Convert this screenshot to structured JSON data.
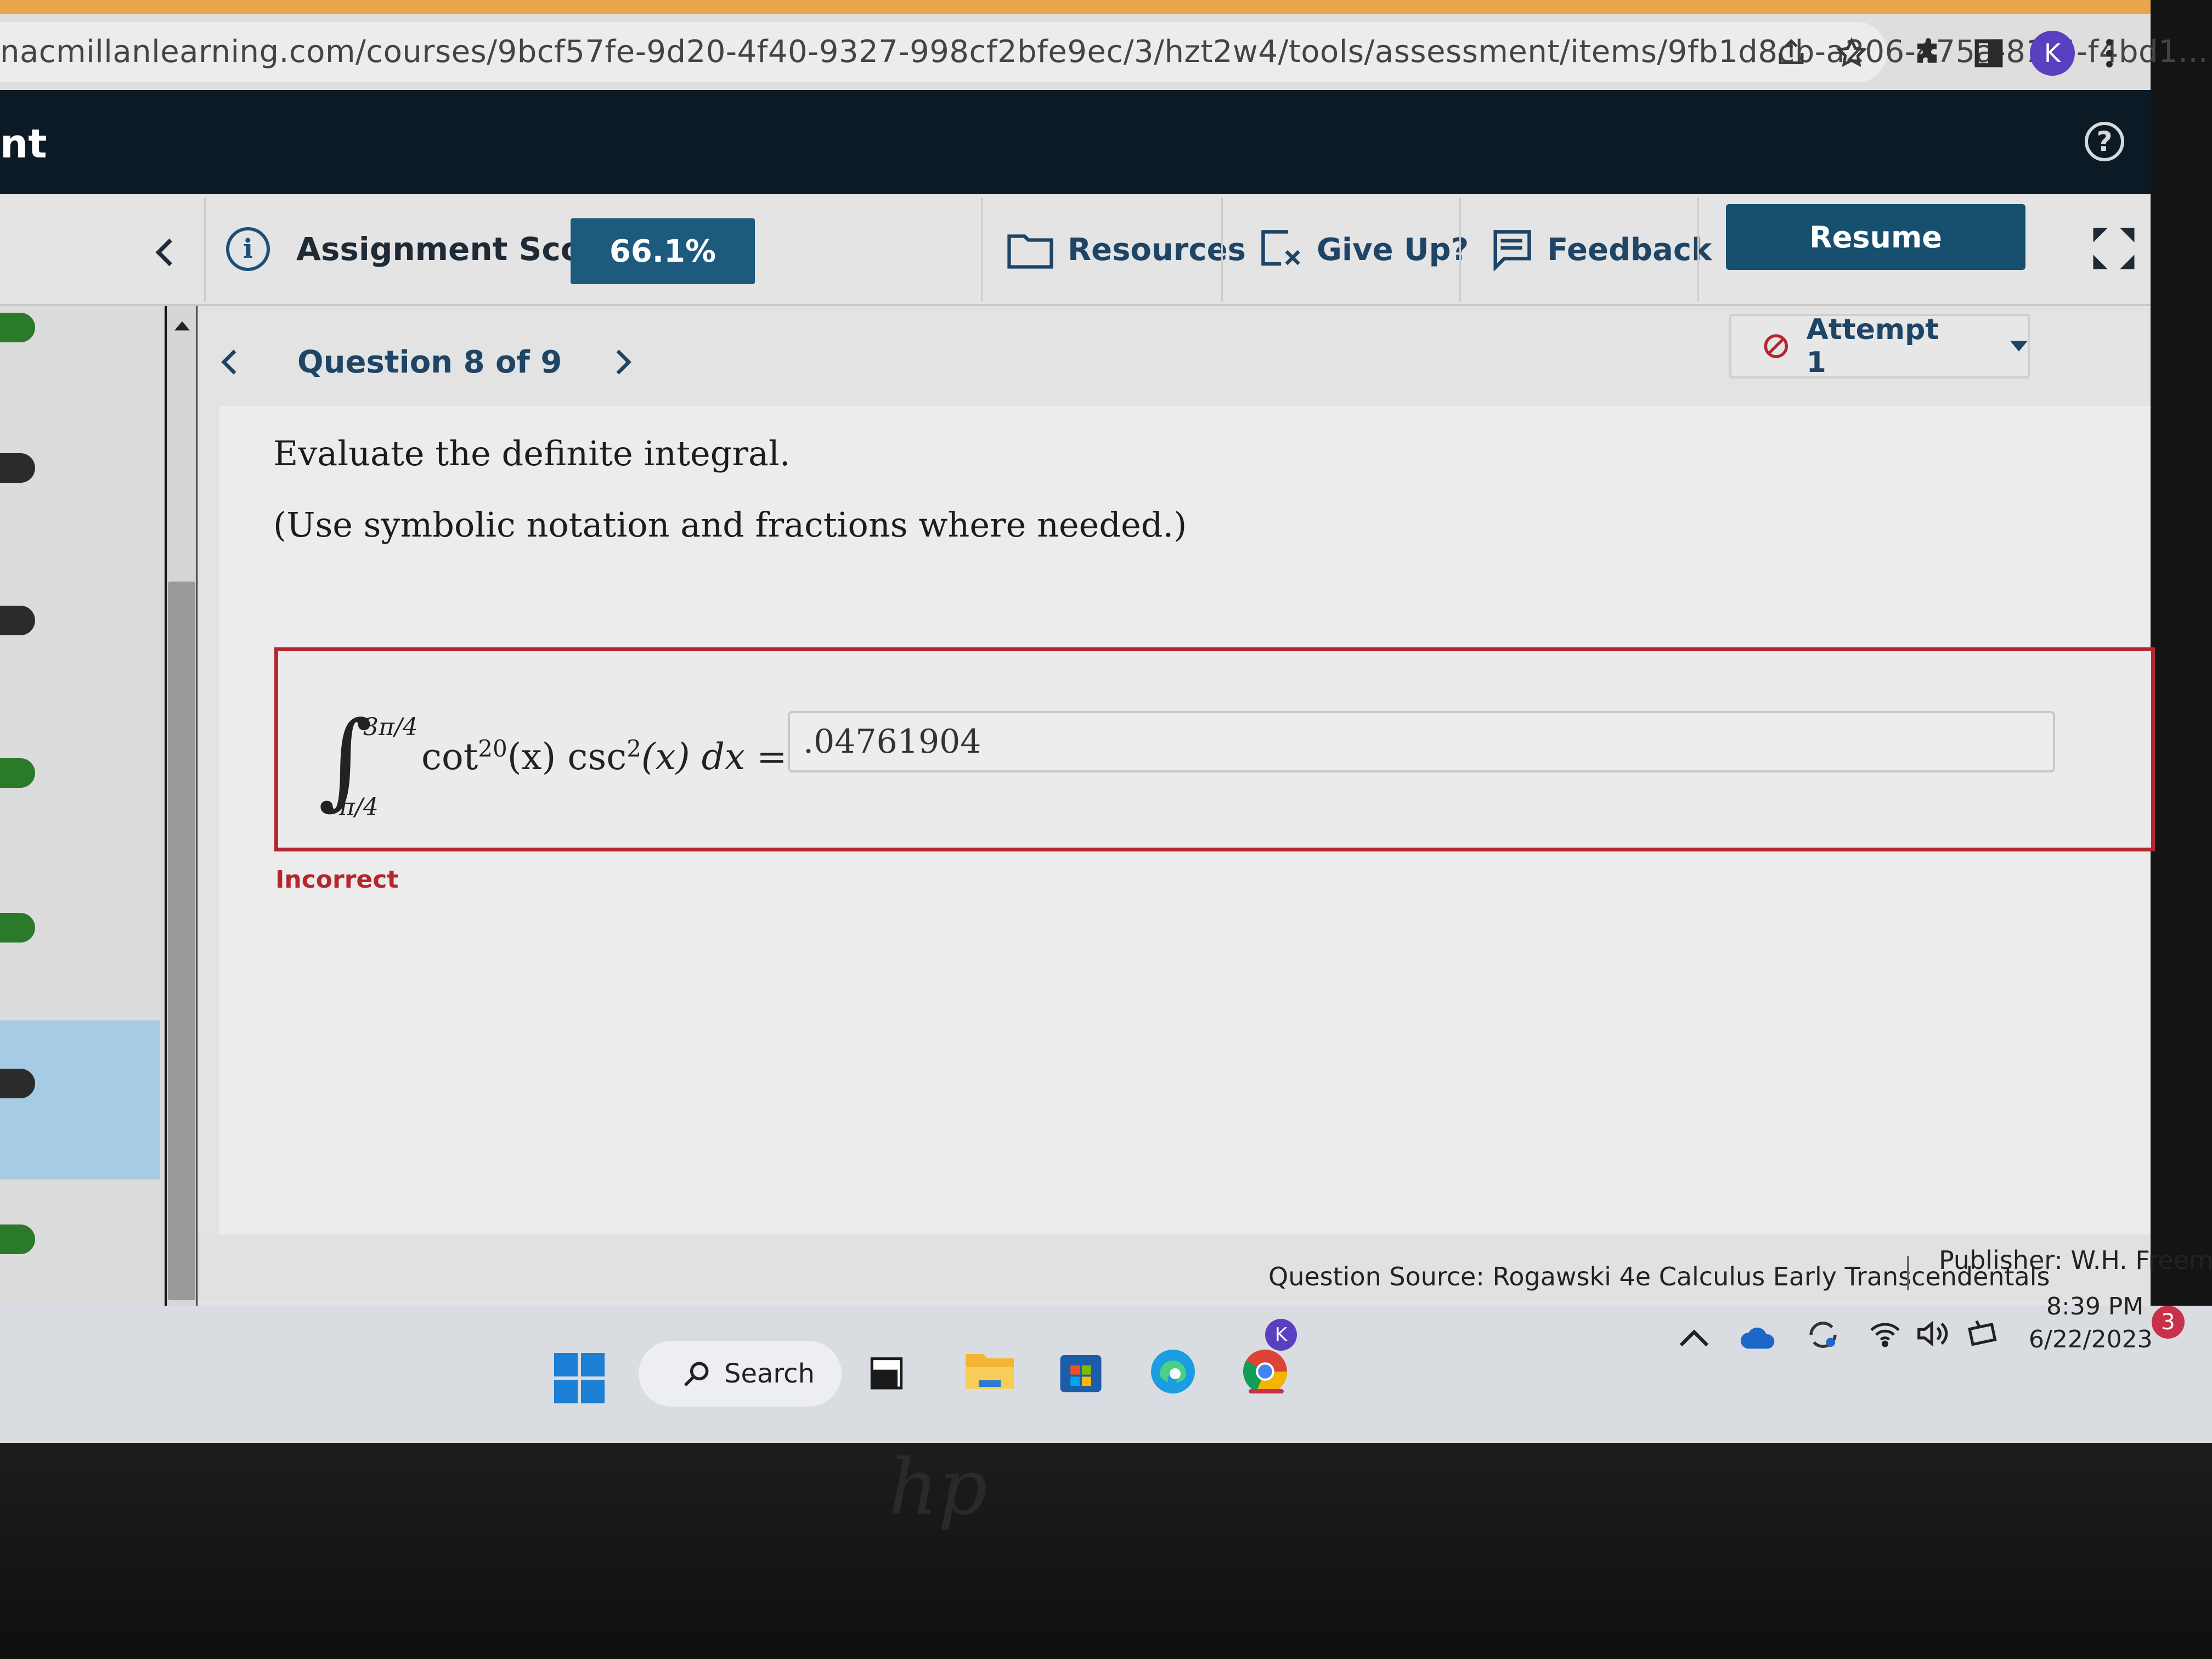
{
  "browser": {
    "url": "nacmillanlearning.com/courses/9bcf57fe-9d20-4f40-9327-998cf2bfe9ec/3/hzt2w4/tools/assessment/items/9fb1d8cb-a206-475a-81f5-f4bd1...",
    "profile_initial": "K"
  },
  "app": {
    "title_fragment": "nt",
    "help_symbol": "?"
  },
  "toolbar": {
    "score_label": "Assignment Score:",
    "score_value": "66.1%",
    "resources_label": "Resources",
    "give_up_label": "Give Up?",
    "feedback_label": "Feedback",
    "resume_label": "Resume"
  },
  "question_nav": {
    "label": "Question 8 of 9",
    "attempt_label": "Attempt 1"
  },
  "question": {
    "prompt": "Evaluate the definite integral.",
    "instruction": "(Use symbolic notation and fractions where needed.)",
    "upper_limit": "3π/4",
    "lower_limit": "π/4",
    "integrand_cot": "cot",
    "integrand_cot_power": "20",
    "integrand_mid": "(x) csc",
    "integrand_csc_power": "2",
    "integrand_tail": "(x) dx =",
    "answer_value": ".04761904",
    "status": "Incorrect"
  },
  "footer": {
    "source": "Question Source: Rogawski 4e Calculus Early Transcendentals",
    "publisher": "Publisher: W.H. Freeman"
  },
  "taskbar": {
    "search_label": "Search",
    "time": "8:39 PM",
    "date": "6/22/2023",
    "notification_count": "3",
    "chrome_badge": "K"
  },
  "colors": {
    "score_badge": "#1d5a7e",
    "resume_button": "#17506f",
    "incorrect_red": "#b52630",
    "sidebar_green": "#2a7a2a",
    "sidebar_dark": "#2b2b2b",
    "sidebar_active": "#a7cbe4"
  }
}
